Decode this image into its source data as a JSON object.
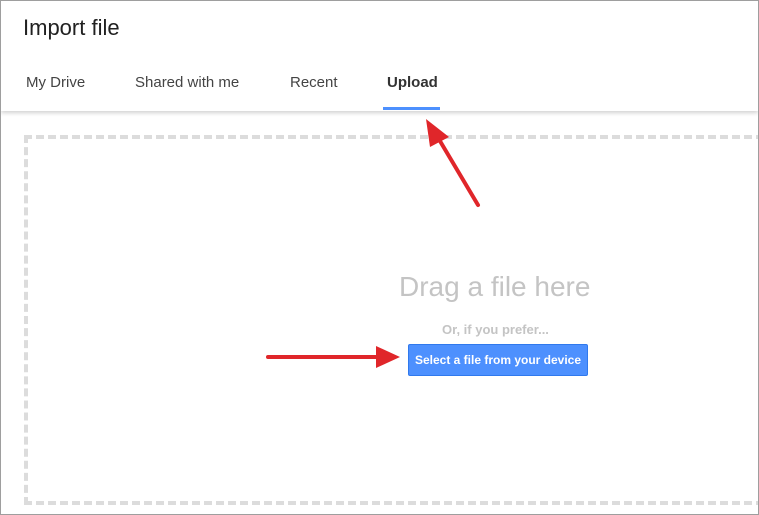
{
  "dialog": {
    "title": "Import file"
  },
  "tabs": [
    {
      "label": "My Drive",
      "selected": false
    },
    {
      "label": "Shared with me",
      "selected": false
    },
    {
      "label": "Recent",
      "selected": false
    },
    {
      "label": "Upload",
      "selected": true
    }
  ],
  "upload": {
    "drag_text": "Drag a file here",
    "prefer_text": "Or, if you prefer...",
    "select_button_label": "Select a file from your device"
  },
  "colors": {
    "accent": "#4d90fe",
    "annotation_arrow": "#e0262a",
    "placeholder_text": "#c4c4c4"
  }
}
